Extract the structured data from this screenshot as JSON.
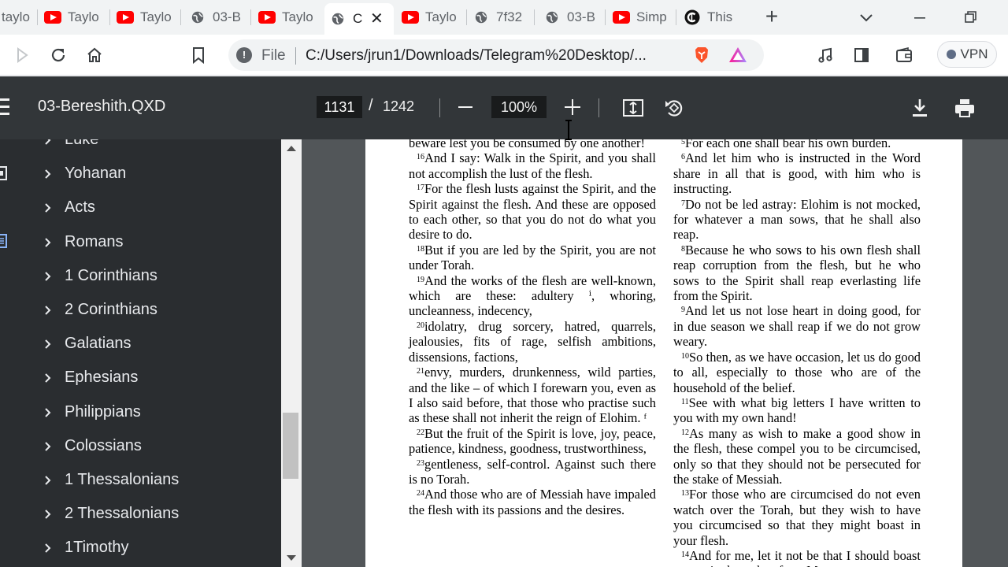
{
  "browser": {
    "tabs": [
      {
        "title": "taylo",
        "icon": "youtube-icon"
      },
      {
        "title": "Taylo",
        "icon": "youtube-icon"
      },
      {
        "title": "Taylo",
        "icon": "youtube-icon"
      },
      {
        "title": "03-B",
        "icon": "globe-icon"
      },
      {
        "title": "Taylo",
        "icon": "youtube-icon"
      },
      {
        "title": "C",
        "icon": "globe-icon"
      },
      {
        "title": "Taylo",
        "icon": "youtube-icon"
      },
      {
        "title": "7f32",
        "icon": "globe-icon"
      },
      {
        "title": "03-B",
        "icon": "globe-icon"
      },
      {
        "title": "Simp",
        "icon": "youtube-icon"
      },
      {
        "title": "This",
        "icon": "c-logo-icon"
      }
    ],
    "omnibox": {
      "scheme": "File",
      "url": "C:/Users/jrun1/Downloads/Telegram%20Desktop/..."
    },
    "vpn_label": "VPN",
    "colors": {
      "youtube_red": "#ff0000",
      "brave_orange": "#fb542b",
      "viewer_bar": "#323639",
      "sidebar_bg": "#2a2d30",
      "doc_bg": "#525659"
    }
  },
  "viewer": {
    "title": "03-Bereshith.QXD",
    "current_page": "1131",
    "page_sep": "/",
    "total_pages": "1242",
    "zoom": "100%"
  },
  "sidebar": {
    "items": [
      {
        "label": "Luke"
      },
      {
        "label": "Yohanan"
      },
      {
        "label": "Acts"
      },
      {
        "label": "Romans"
      },
      {
        "label": "1 Corinthians"
      },
      {
        "label": "2 Corinthians"
      },
      {
        "label": "Galatians"
      },
      {
        "label": "Ephesians"
      },
      {
        "label": "Philippians"
      },
      {
        "label": "Colossians"
      },
      {
        "label": "1 Thessalonians"
      },
      {
        "label": "2 Thessalonians"
      },
      {
        "label": "1Timothy"
      }
    ]
  },
  "document": {
    "left_column": [
      {
        "num": "",
        "text": "beware lest you be consumed by one another!"
      },
      {
        "num": "16",
        "text": "And I say: Walk in the Spirit, and you shall not accomplish the lust of the flesh."
      },
      {
        "num": "17",
        "text": "For the flesh lusts against the Spirit, and the Spirit against the flesh. And these are opposed to each other, so that you do not do what you desire to do."
      },
      {
        "num": "18",
        "text": "But if you are led by the Spirit, you are not under Torah."
      },
      {
        "num": "19",
        "text": "And the works of the flesh are well-known, which are these: adultery ⁱ, whoring, uncleanness, indecency,"
      },
      {
        "num": "20",
        "text": "idolatry, drug sorcery, hatred, quarrels, jealousies, fits of rage, selfish ambitions, dissensions, factions,"
      },
      {
        "num": "21",
        "text": "envy, murders, drunkenness, wild parties, and the like – of which I forewarn you, even as I also said before, that those who practise such as these shall not inherit the reign of Elohim. ᶠ"
      },
      {
        "num": "22",
        "text": "But the fruit of the Spirit is love, joy, peace, patience, kindness, goodness, trustworthiness,"
      },
      {
        "num": "23",
        "text": "gentleness, self-control. Against such there is no Torah."
      },
      {
        "num": "24",
        "text": "And those who are of Messiah have impaled the flesh with its passions and the desires."
      }
    ],
    "right_column": [
      {
        "num": "5",
        "text": "For each one shall bear his own burden."
      },
      {
        "num": "6",
        "text": "And let him who is instructed in the Word share in all that is good, with him who is instructing."
      },
      {
        "num": "7",
        "text": "Do not be led astray: Elohim is not mocked, for whatever a man sows, that he shall also reap."
      },
      {
        "num": "8",
        "text": "Because he who sows to his own flesh shall reap corruption from the flesh, but he who sows to the Spirit shall reap everlasting life from the Spirit."
      },
      {
        "num": "9",
        "text": "And let us not lose heart in doing good, for in due season we shall reap if we do not grow weary."
      },
      {
        "num": "10",
        "text": "So then, as we have occasion, let us do good to all, especially to those who are of the household of the belief."
      },
      {
        "num": "11",
        "text": "See with what big letters I have written to you with my own hand!"
      },
      {
        "num": "12",
        "text": "As many as wish to make a good show in the flesh, these compel you to be circumcised, only so that they should not be persecuted for the stake of Messiah."
      },
      {
        "num": "13",
        "text": "For those who are circumcised do not even watch over the Torah, but they wish to have you circumcised so that they might boast in your flesh."
      },
      {
        "num": "14",
        "text": "And for me, let it not be that I should boast except in the stake of our Master"
      }
    ]
  }
}
